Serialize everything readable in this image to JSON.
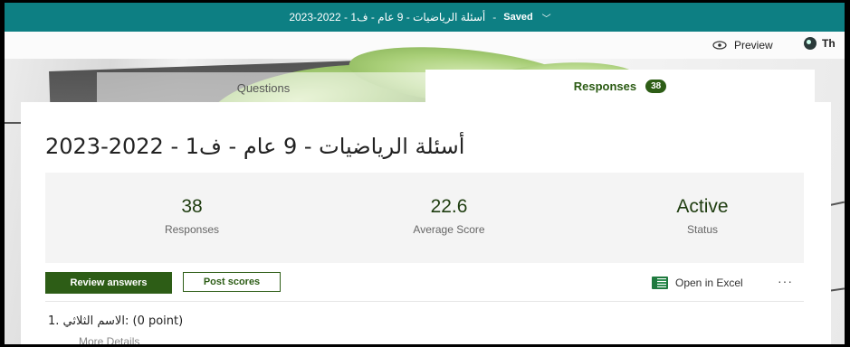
{
  "topbar": {
    "title": "أسئلة الرياضيات - 9 عام - ف1 - 2022-2023",
    "separator": "-",
    "saved": "Saved",
    "chevron": "﹀"
  },
  "toolbar": {
    "preview_label": "Preview",
    "theme_label": "Th"
  },
  "tabs": {
    "questions_label": "Questions",
    "responses_label": "Responses",
    "responses_count": "38"
  },
  "form": {
    "title": "أسئلة الرياضيات - 9 عام - ف1 - 2022-2023"
  },
  "stats": {
    "responses_value": "38",
    "responses_label": "Responses",
    "average_value": "22.6",
    "average_label": "Average Score",
    "status_value": "Active",
    "status_label": "Status"
  },
  "actions": {
    "review_answers": "Review answers",
    "post_scores": "Post scores",
    "open_in_excel": "Open in Excel",
    "more": "···"
  },
  "question": {
    "text": "1. الاسم الثلاثي: (0 point)",
    "more_details": "More Details"
  },
  "colors": {
    "topbar": "#0d7f83",
    "accent_green": "#2d5d16",
    "excel_green": "#1f7a3f"
  }
}
